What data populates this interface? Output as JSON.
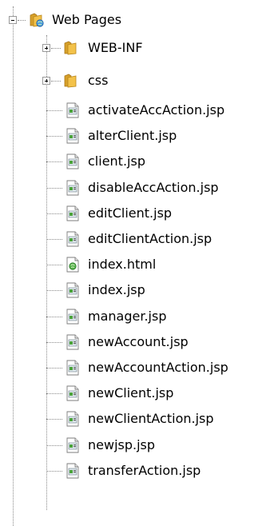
{
  "tree": {
    "root": {
      "label": "Web Pages",
      "icon": "web-pages-folder-icon",
      "expanded": true
    },
    "folders": [
      {
        "label": "WEB-INF",
        "icon": "folder-icon",
        "expanded": false
      },
      {
        "label": "css",
        "icon": "folder-icon",
        "expanded": false
      }
    ],
    "files": [
      {
        "label": "activateAccAction.jsp",
        "icon": "jsp-file-icon"
      },
      {
        "label": "alterClient.jsp",
        "icon": "jsp-file-icon"
      },
      {
        "label": "client.jsp",
        "icon": "jsp-file-icon"
      },
      {
        "label": "disableAccAction.jsp",
        "icon": "jsp-file-icon"
      },
      {
        "label": "editClient.jsp",
        "icon": "jsp-file-icon"
      },
      {
        "label": "editClientAction.jsp",
        "icon": "jsp-file-icon"
      },
      {
        "label": "index.html",
        "icon": "html-file-icon"
      },
      {
        "label": "index.jsp",
        "icon": "jsp-file-icon"
      },
      {
        "label": "manager.jsp",
        "icon": "jsp-file-icon"
      },
      {
        "label": "newAccount.jsp",
        "icon": "jsp-file-icon"
      },
      {
        "label": "newAccountAction.jsp",
        "icon": "jsp-file-icon"
      },
      {
        "label": "newClient.jsp",
        "icon": "jsp-file-icon"
      },
      {
        "label": "newClientAction.jsp",
        "icon": "jsp-file-icon"
      },
      {
        "label": "newjsp.jsp",
        "icon": "jsp-file-icon"
      },
      {
        "label": "transferAction.jsp",
        "icon": "jsp-file-icon"
      }
    ]
  }
}
